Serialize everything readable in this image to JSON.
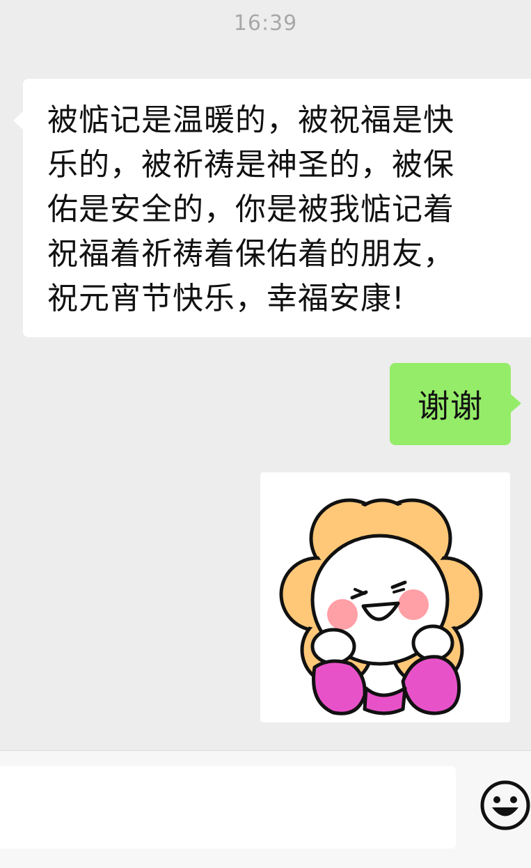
{
  "chat": {
    "timestamp": "16:39",
    "messages": [
      {
        "side": "left",
        "type": "text",
        "text": "被惦记是温暖的，被祝福是快\n乐的，被祈祷是神圣的，被保\n佑是安全的，你是被我惦记着\n祝福着祈祷着保佑着的朋友，\n祝元宵节快乐，幸福安康!"
      },
      {
        "side": "right",
        "type": "text",
        "text": "谢谢"
      },
      {
        "side": "right",
        "type": "sticker",
        "sticker": "smiling-flower-character-sticker"
      }
    ]
  },
  "input_bar": {
    "emoji_icon": "smiley-face-icon"
  },
  "colors": {
    "background": "#ededed",
    "incoming_bubble": "#ffffff",
    "outgoing_bubble": "#95ec69",
    "timestamp_text": "#a8a8a8",
    "sticker_petals": "#ffc878",
    "sticker_sleeves": "#e852c8",
    "sticker_blush": "#ff9fa6"
  }
}
